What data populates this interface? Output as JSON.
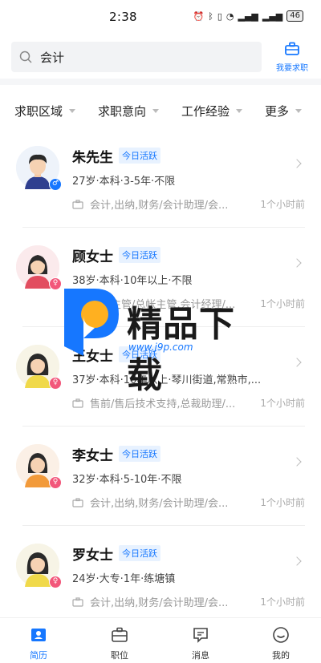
{
  "status_bar": {
    "time": "2:38",
    "battery": "46"
  },
  "search": {
    "value": "会计"
  },
  "my_job": {
    "label": "我要求职"
  },
  "filters": [
    {
      "label": "求职区域"
    },
    {
      "label": "求职意向"
    },
    {
      "label": "工作经验"
    },
    {
      "label": "更多"
    }
  ],
  "candidates": [
    {
      "name": "朱先生",
      "badge": "今日活跃",
      "gender": "male",
      "meta": "27岁·本科·3-5年·不限",
      "intent": "会计,出纳,财务/会计助理/会...",
      "time": "1个小时前"
    },
    {
      "name": "顾女士",
      "badge": "今日活跃",
      "gender": "female",
      "meta": "38岁·本科·10年以上·不限",
      "intent": "财务主管/总帐主管,会计经理/...",
      "time": "1个小时前"
    },
    {
      "name": "王女士",
      "badge": "今日活跃",
      "gender": "female",
      "meta": "37岁·本科·10年以上·琴川街道,常熟市,...",
      "intent": "售前/售后技术支持,总裁助理/...",
      "time": "1个小时前"
    },
    {
      "name": "李女士",
      "badge": "今日活跃",
      "gender": "female",
      "meta": "32岁·本科·5-10年·不限",
      "intent": "会计,出纳,财务/会计助理/会...",
      "time": "1个小时前"
    },
    {
      "name": "罗女士",
      "badge": "今日活跃",
      "gender": "female",
      "meta": "24岁·大专·1年·练塘镇",
      "intent": "会计,出纳,财务/会计助理/会...",
      "time": "1个小时前"
    }
  ],
  "watermark": {
    "text": "精品下载",
    "url": "www.j9p.com"
  },
  "tabs": [
    {
      "label": "简历",
      "active": true
    },
    {
      "label": "职位",
      "active": false
    },
    {
      "label": "消息",
      "active": false
    },
    {
      "label": "我的",
      "active": false
    }
  ],
  "colors": {
    "accent": "#1677ff",
    "female": "#f2577a"
  }
}
